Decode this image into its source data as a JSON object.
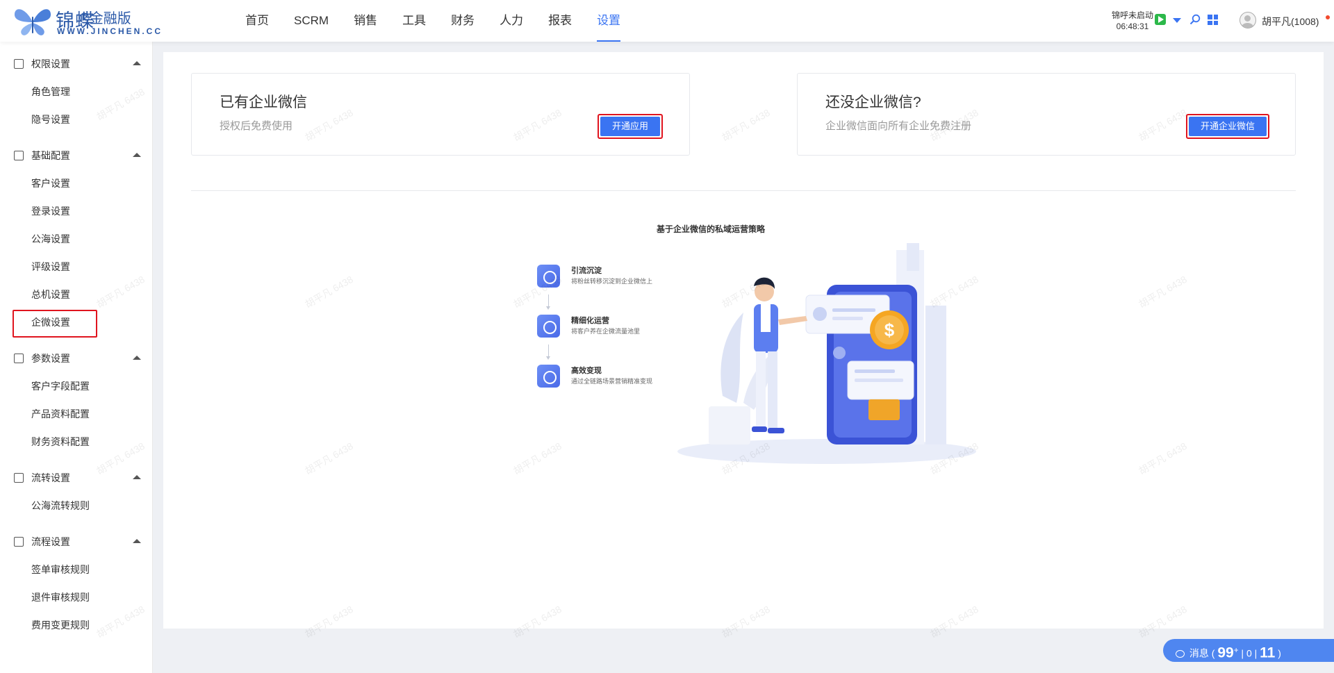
{
  "header": {
    "brand_cn": "锦蝶",
    "brand_sup": "®金融版",
    "brand_url": "WWW.JINCHEN.CC",
    "nav": [
      "首页",
      "SCRM",
      "销售",
      "工具",
      "财务",
      "人力",
      "报表",
      "设置"
    ],
    "active_nav": "设置",
    "call_status": "锦呼未启动",
    "time": "06:48:31",
    "user": "胡平凡(1008)"
  },
  "sidebar": {
    "groups": [
      {
        "label": "权限设置",
        "icon": "permission-icon",
        "items": [
          "角色管理",
          "隐号设置"
        ]
      },
      {
        "label": "基础配置",
        "icon": "layout-icon",
        "items": [
          "客户设置",
          "登录设置",
          "公海设置",
          "评级设置",
          "总机设置",
          "企微设置"
        ]
      },
      {
        "label": "参数设置",
        "icon": "params-icon",
        "items": [
          "客户字段配置",
          "产品资料配置",
          "财务资料配置"
        ]
      },
      {
        "label": "流转设置",
        "icon": "transfer-icon",
        "items": [
          "公海流转规则"
        ]
      },
      {
        "label": "流程设置",
        "icon": "flow-icon",
        "items": [
          "签单审核规则",
          "退件审核规则",
          "费用变更规则"
        ]
      }
    ],
    "selected_item": "企微设置"
  },
  "cards": {
    "has_wecom": {
      "title": "已有企业微信",
      "subtitle": "授权后免费使用",
      "button": "开通应用"
    },
    "no_wecom": {
      "title": "还没企业微信?",
      "subtitle": "企业微信面向所有企业免费注册",
      "button": "开通企业微信"
    }
  },
  "strategy": {
    "title": "基于企业微信的私域运营策略",
    "steps": [
      {
        "name": "引流沉淀",
        "desc": "将粉丝转移沉淀到企业微信上",
        "icon": "cloud-icon"
      },
      {
        "name": "精细化运营",
        "desc": "将客户养在企微流量池里",
        "icon": "operation-icon"
      },
      {
        "name": "高效变现",
        "desc": "通过全链路场景营销精准变现",
        "icon": "money-hand-icon"
      }
    ]
  },
  "watermark": "胡平凡 6438",
  "messages": {
    "label": "消息",
    "count": "99",
    "count_plus": "+",
    "second": "0",
    "third": "11"
  },
  "colors": {
    "accent": "#3a74f2",
    "highlight_border": "#e0141e",
    "coin": "#f5a623"
  }
}
